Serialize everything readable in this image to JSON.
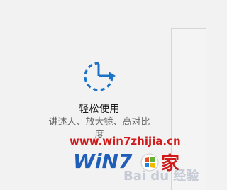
{
  "tile": {
    "icon": "ease-of-access-icon",
    "title": "轻松使用",
    "description": "讲述人、放大镜、高对比度"
  },
  "watermark": {
    "url_text": "www.win7zhijia.cn",
    "logo_text": "WiN7",
    "logo_suffix": "家",
    "baidu_text": "Bai du 经验"
  }
}
